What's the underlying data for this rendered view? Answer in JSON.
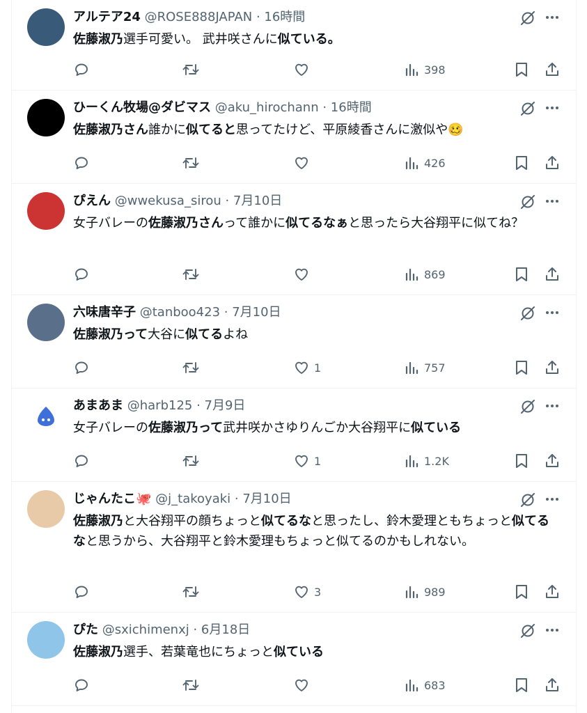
{
  "tweets": [
    {
      "name": "アルテア24",
      "handle": "@ROSE888JAPAN",
      "time": "16時間",
      "body": [
        {
          "t": "佐藤淑乃",
          "b": true
        },
        {
          "t": "選手可愛い。 武井咲さんに",
          "b": false
        },
        {
          "t": "似ている。",
          "b": true
        }
      ],
      "likes": "",
      "views": "398",
      "avatar_color": "#3a5a7a"
    },
    {
      "name": "ひーくん牧場@ダビマス",
      "handle": "@aku_hirochann",
      "time": "16時間",
      "body": [
        {
          "t": "佐藤淑乃さん",
          "b": true
        },
        {
          "t": "誰かに",
          "b": false
        },
        {
          "t": "似てると",
          "b": true
        },
        {
          "t": "思ってたけど、平原綾香さんに激似や🥴",
          "b": false
        }
      ],
      "likes": "",
      "views": "426",
      "avatar_color": "#000000"
    },
    {
      "name": "ぴえん",
      "handle": "@wwekusa_sirou",
      "time": "7月10日",
      "body": [
        {
          "t": "女子バレーの",
          "b": false
        },
        {
          "t": "佐藤淑乃さん",
          "b": true
        },
        {
          "t": "って誰かに",
          "b": false
        },
        {
          "t": "似てるなぁ",
          "b": true
        },
        {
          "t": "と思ったら大谷翔平に似てね？",
          "b": false
        }
      ],
      "likes": "",
      "views": "869",
      "avatar_color": "#c33"
    },
    {
      "name": "六味唐辛子",
      "handle": "@tanboo423",
      "time": "7月10日",
      "body": [
        {
          "t": "佐藤淑乃って",
          "b": true
        },
        {
          "t": "大谷に",
          "b": false
        },
        {
          "t": "似てる",
          "b": true
        },
        {
          "t": "よね",
          "b": false
        }
      ],
      "likes": "1",
      "views": "757",
      "avatar_color": "#5a6f8a"
    },
    {
      "name": "あまあま",
      "handle": "@harb125",
      "time": "7月9日",
      "body": [
        {
          "t": "女子バレーの",
          "b": false
        },
        {
          "t": "佐藤淑乃って",
          "b": true
        },
        {
          "t": "武井咲かさゆりんごか大谷翔平に",
          "b": false
        },
        {
          "t": "似ている",
          "b": true
        }
      ],
      "likes": "1",
      "views": "1.2K",
      "avatar_color": "#ffffff"
    },
    {
      "name": "じゃんたこ🐙",
      "handle": "@j_takoyaki",
      "time": "7月10日",
      "body": [
        {
          "t": "佐藤淑乃",
          "b": true
        },
        {
          "t": "と大谷翔平の顔ちょっと",
          "b": false
        },
        {
          "t": "似てるな",
          "b": true
        },
        {
          "t": "と思ったし、鈴木愛理ともちょっと",
          "b": false
        },
        {
          "t": "似てるな",
          "b": true
        },
        {
          "t": "と思うから、大谷翔平と鈴木愛理もちょっと似てるのかもしれない。",
          "b": false
        }
      ],
      "likes": "3",
      "views": "989",
      "avatar_color": "#e8c9a8"
    },
    {
      "name": "ぴた",
      "handle": "@sxichimenxj",
      "time": "6月18日",
      "body": [
        {
          "t": "佐藤淑乃",
          "b": true
        },
        {
          "t": "選手、若葉竜也にちょっと",
          "b": false
        },
        {
          "t": "似ている",
          "b": true
        }
      ],
      "likes": "",
      "views": "683",
      "avatar_color": "#8ec5e8"
    }
  ],
  "icons": {
    "reply": "reply-icon",
    "retweet": "retweet-icon",
    "like": "heart-icon",
    "views": "views-chart-icon",
    "bookmark": "bookmark-icon",
    "share": "share-icon",
    "grok": "grok-icon",
    "more": "more-icon"
  },
  "colors": {
    "text": "#0f1419",
    "muted": "#536471",
    "border": "#eff3f4"
  }
}
